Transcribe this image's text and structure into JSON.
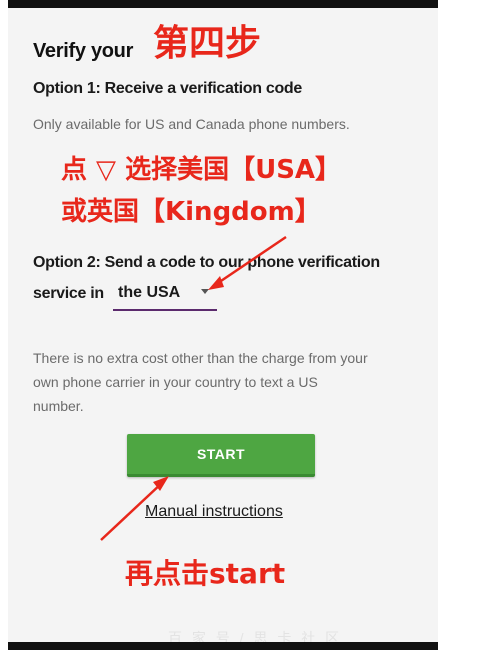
{
  "page": {
    "title": "Verify your",
    "option1": {
      "heading": "Option 1: Receive a verification code",
      "note": "Only available for US and Canada phone numbers."
    },
    "option2": {
      "heading_line1": "Option 2: Send a code to our phone verification",
      "heading_line2_prefix": "service in",
      "country_select_value": "the USA"
    },
    "cost_note": {
      "line1": "There is no extra cost other than the charge from your",
      "line2": "own phone carrier in your country to text a US",
      "line3": "number."
    },
    "start_button_label": "START",
    "manual_link": "Manual instructions"
  },
  "annotations": {
    "step": "第四步",
    "line1": "点 ▽ 选择美国【USA】",
    "line2": "或英国【Kingdom】",
    "line3": "再点击start",
    "watermark": "百 家 号 / 思 卡 社 区"
  },
  "colors": {
    "annotation_red": "#e8271b",
    "start_green": "#4ea642",
    "select_underline": "#5b2a6d"
  }
}
